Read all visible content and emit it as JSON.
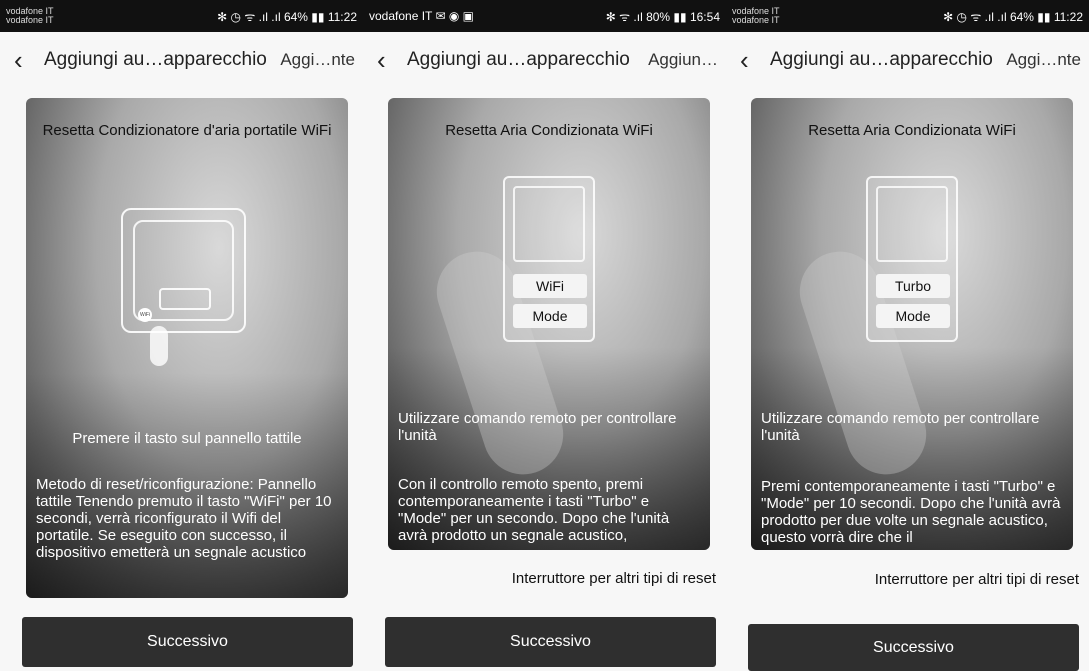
{
  "screens": [
    {
      "status": {
        "carrier1": "vodafone IT",
        "carrier2": "vodafone IT",
        "right": "✻ ◷ ᯤ .ıl .ıl 64% ▮▮ 11:22"
      },
      "header": {
        "title": "Aggiungi au…apparecchio",
        "action": "Aggi…nte"
      },
      "card": {
        "title": "Resetta Condizionatore d'aria portatile WiFi",
        "device_dot": "WiFi",
        "caption": "Premere il tasto sul pannello tattile",
        "description": "Metodo di reset/riconfigurazione: Pannello tattile Tenendo premuto il tasto \"WiFi\" per 10 secondi, verrà riconfigurato il Wifi del portatile. Se eseguito con successo, il dispositivo emetterà un segnale acustico"
      },
      "next_label": "Successivo"
    },
    {
      "status": {
        "carrier": "vodafone IT ✉ ◉ ▣",
        "right": "✻ ᯤ .ıl 80% ▮▮ 16:54"
      },
      "header": {
        "title": "Aggiungi au…apparecchio",
        "action": "Aggiun…"
      },
      "card": {
        "title": "Resetta Aria Condizionata WiFi",
        "btn1": "WiFi",
        "btn2": "Mode",
        "caption": "Utilizzare comando remoto per controllare l'unità",
        "description": "Con il controllo remoto spento, premi contemporaneamente i tasti \"Turbo\" e \"Mode\" per un secondo. Dopo che l'unità avrà prodotto un segnale acustico,"
      },
      "link": "Interruttore per altri tipi di reset",
      "next_label": "Successivo"
    },
    {
      "status": {
        "carrier1": "vodafone IT",
        "carrier2": "vodafone IT",
        "right": "✻ ◷ ᯤ .ıl .ıl 64% ▮▮ 11:22"
      },
      "header": {
        "title": "Aggiungi au…apparecchio",
        "action": "Aggi…nte"
      },
      "card": {
        "title": "Resetta Aria Condizionata WiFi",
        "btn1": "Turbo",
        "btn2": "Mode",
        "caption": "Utilizzare comando remoto per controllare l'unità",
        "description": "Premi contemporaneamente i tasti \"Turbo\" e \"Mode\" per 10 secondi. Dopo che l'unità avrà prodotto per due volte un segnale acustico, questo vorrà dire che il"
      },
      "link": "Interruttore per altri tipi di reset",
      "next_label": "Successivo"
    }
  ]
}
